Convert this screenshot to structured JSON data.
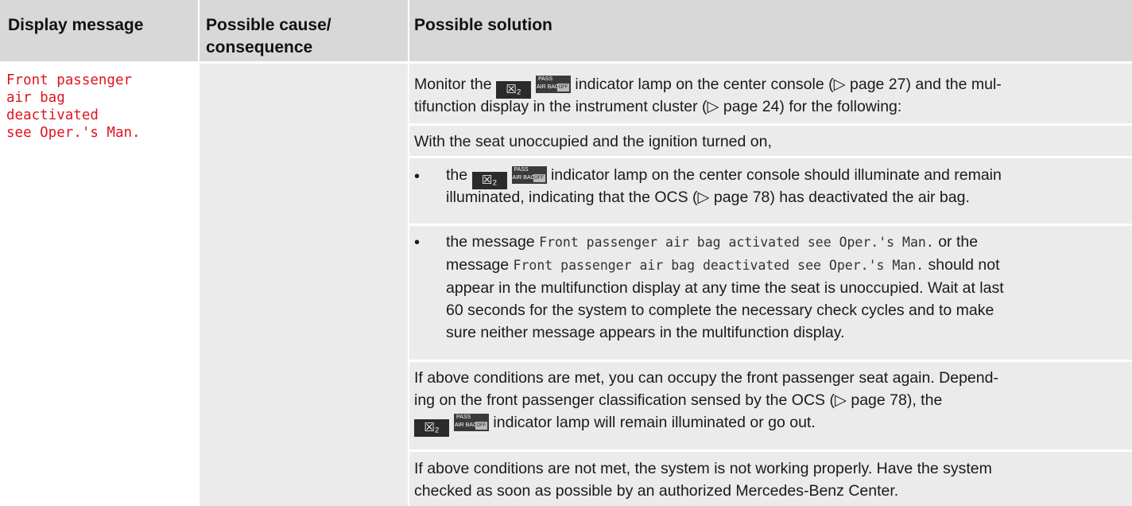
{
  "headers": {
    "col1": "Display message",
    "col2_line1": "Possible cause/",
    "col2_line2": "consequence",
    "col3": "Possible solution"
  },
  "display_message": {
    "lines": [
      "Front passenger",
      "air bag",
      "deactivated",
      "see Oper.'s Man."
    ],
    "color": "#e0141e"
  },
  "icons": {
    "airbag_icon": "airbag-person-icon",
    "indicator_icon": "pass-air-bag-off-icon",
    "indicator_text_top": "PASS",
    "indicator_text_bottom": "AIR BAG",
    "indicator_off": "OFF"
  },
  "solution": {
    "p1_pre": "Monitor the",
    "p1_post_line1": "indicator lamp on the center console (▷ page 27) and the mul-",
    "p1_line2": "tifunction display in the instrument cluster (▷ page 24) for the following:",
    "p2": "With the seat unoccupied and the ignition turned on,",
    "bullet_char": "•",
    "b1_pre": "the",
    "b1_post_line1": "indicator lamp on the center console should illuminate and remain",
    "b1_line2": "illuminated, indicating that the OCS (▷ page 78) has deactivated the air bag.",
    "b2_l1_a": "the message ",
    "b2_l1_mono": "Front passenger air bag activated see Oper.'s Man.",
    "b2_l1_b": " or the",
    "b2_l2_a": "message ",
    "b2_l2_mono": "Front passenger air bag deactivated see Oper.'s Man.",
    "b2_l2_b": " should not",
    "b2_l3": "appear in the multifunction display at any time the seat is unoccupied. Wait at last",
    "b2_l4": "60 seconds for the system to complete the necessary check cycles and to make",
    "b2_l5": "sure neither message appears in the multifunction display.",
    "p3_l1": "If above conditions are met, you can occupy the front passenger seat again. Depend-",
    "p3_l2": "ing on the front passenger classification sensed by the OCS (▷ page 78), the",
    "p3_l3_post": "indicator lamp will remain illuminated or go out.",
    "p4_l1": "If above conditions are not met, the system is not working properly. Have the system",
    "p4_l2": "checked as soon as possible by an authorized Mercedes-Benz Center."
  }
}
